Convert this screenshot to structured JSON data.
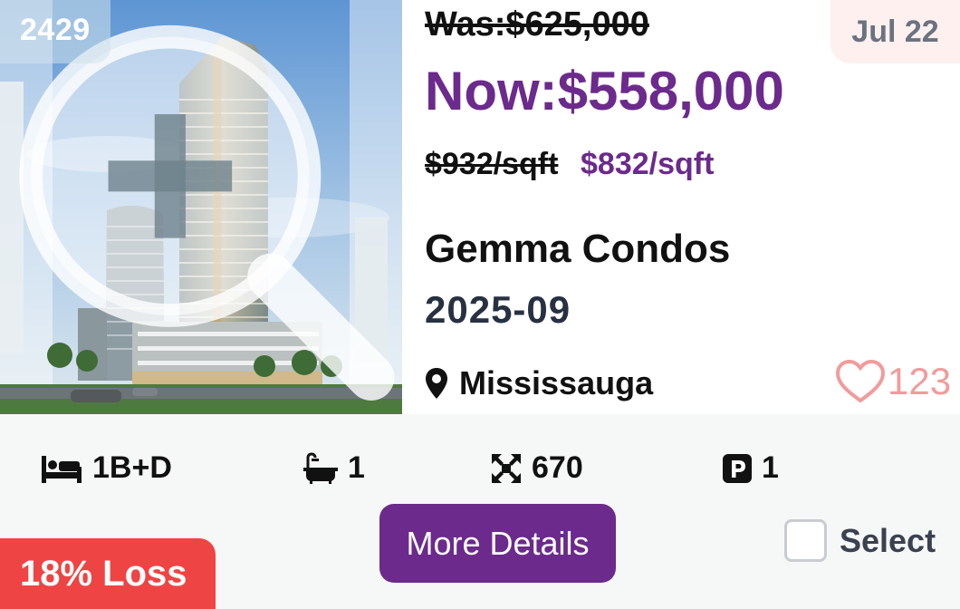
{
  "listing": {
    "id_badge": "2429",
    "was_price": "Was:$625,000",
    "now_price": "Now:$558,000",
    "old_price_per_sqft": "$932/sqft",
    "new_price_per_sqft": "$832/sqft",
    "date_badge": "Jul 22",
    "project_name": "Gemma Condos",
    "occupancy": "2025-09",
    "location": "Mississauga",
    "likes": "123",
    "loss_badge": "18% Loss"
  },
  "specs": {
    "beds": "1B+D",
    "baths": "1",
    "size": "670",
    "parking": "1"
  },
  "actions": {
    "details_label": "More Details",
    "select_label": "Select"
  },
  "icons": {
    "zoom": "zoom-in-icon",
    "location": "map-pin-icon",
    "likes": "heart-outline-icon",
    "beds": "bed-icon",
    "baths": "bathtub-icon",
    "size": "expand-arrows-icon",
    "parking": "parking-icon"
  },
  "colors": {
    "accent": "#6b2a8c",
    "loss": "#ef4444",
    "heart": "#f29b9b",
    "date_badge_bg": "#fdf0ef"
  }
}
